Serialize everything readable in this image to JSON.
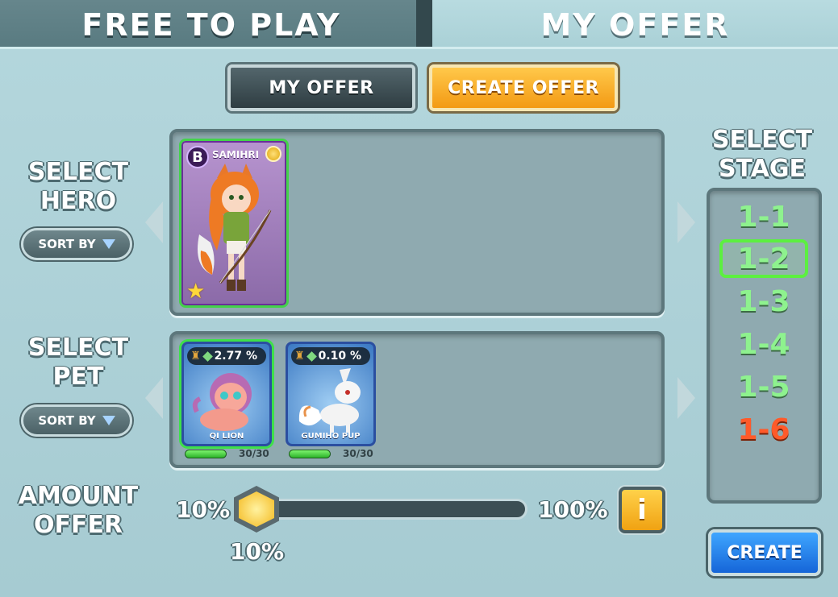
{
  "tabs": [
    {
      "label": "FREE TO PLAY",
      "active": false
    },
    {
      "label": "MY OFFER",
      "active": true
    }
  ],
  "subtabs": {
    "my_offer": "MY OFFER",
    "create_offer": "CREATE OFFER"
  },
  "hero_section": {
    "label_line1": "SELECT",
    "label_line2": "HERO",
    "sort_label": "SORT BY",
    "heroes": [
      {
        "name": "SAMIHRI",
        "badge": "B",
        "stars": 1,
        "icon": "fox-archer-portrait"
      }
    ]
  },
  "pet_section": {
    "label_line1": "SELECT",
    "label_line2": "PET",
    "sort_label": "SORT BY",
    "pets": [
      {
        "name": "QI LION",
        "percent": "2.77 %",
        "count": "30/30",
        "level_fill": 1.0,
        "selected": true
      },
      {
        "name": "GUMIHO PUP",
        "percent": "0.10 %",
        "count": "30/30",
        "level_fill": 1.0,
        "selected": false
      }
    ]
  },
  "stage_section": {
    "label_line1": "SELECT",
    "label_line2": "STAGE",
    "stages": [
      {
        "label": "1-1",
        "state": "normal"
      },
      {
        "label": "1-2",
        "state": "selected"
      },
      {
        "label": "1-3",
        "state": "normal"
      },
      {
        "label": "1-4",
        "state": "normal"
      },
      {
        "label": "1-5",
        "state": "normal"
      },
      {
        "label": "1-6",
        "state": "locked"
      }
    ]
  },
  "amount_section": {
    "label_line1": "AMOUNT",
    "label_line2": "OFFER",
    "min_label": "10%",
    "max_label": "100%",
    "current_label": "10%",
    "slider_value": 0.0,
    "info_label": "i"
  },
  "create_button": "CREATE",
  "colors": {
    "accent_orange": "#f39a14",
    "create_blue": "#1565d8",
    "selected_green": "#5cf040",
    "locked_red": "#ff5a2a"
  }
}
